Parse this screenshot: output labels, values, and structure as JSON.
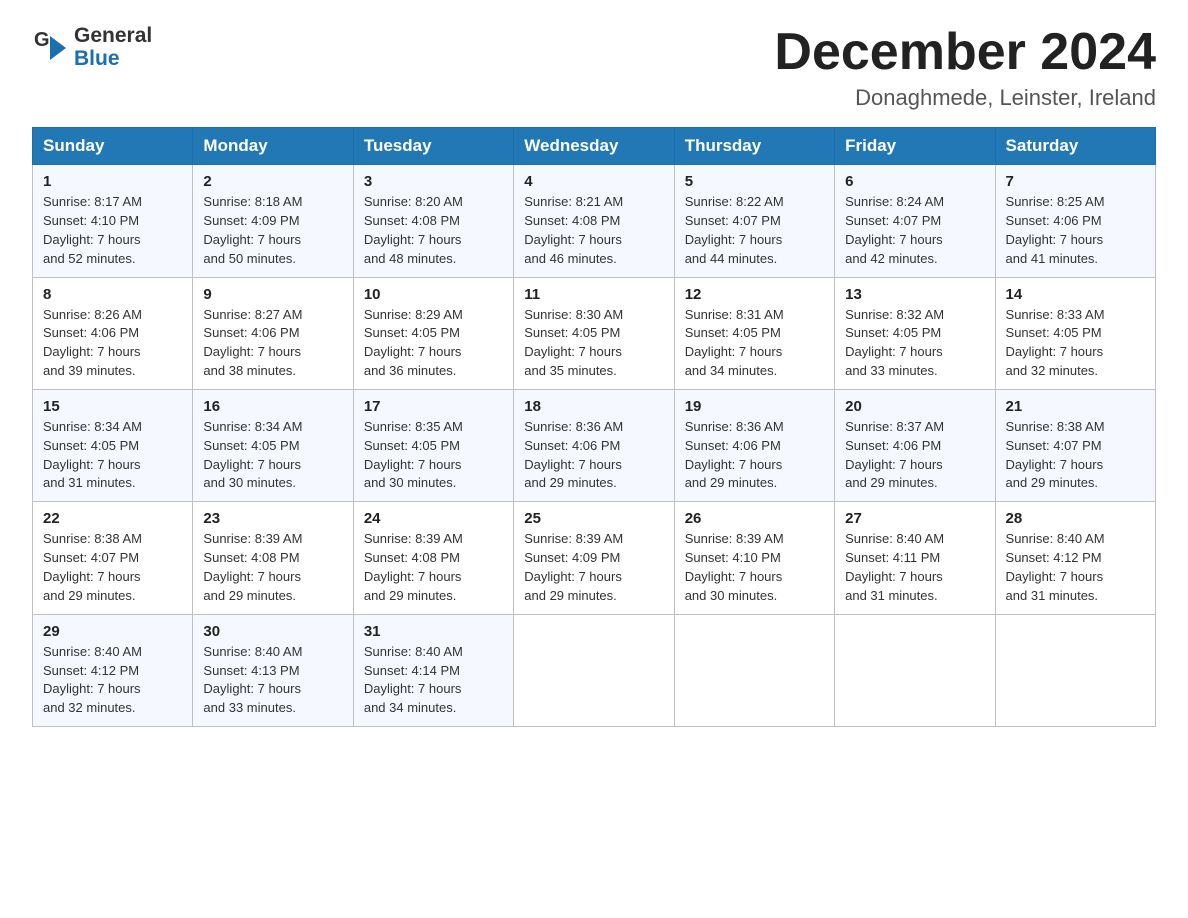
{
  "header": {
    "logo": {
      "general_text": "General",
      "blue_text": "Blue"
    },
    "title": "December 2024",
    "location": "Donaghmede, Leinster, Ireland"
  },
  "columns": [
    "Sunday",
    "Monday",
    "Tuesday",
    "Wednesday",
    "Thursday",
    "Friday",
    "Saturday"
  ],
  "weeks": [
    [
      {
        "day": "1",
        "info": "Sunrise: 8:17 AM\nSunset: 4:10 PM\nDaylight: 7 hours\nand 52 minutes."
      },
      {
        "day": "2",
        "info": "Sunrise: 8:18 AM\nSunset: 4:09 PM\nDaylight: 7 hours\nand 50 minutes."
      },
      {
        "day": "3",
        "info": "Sunrise: 8:20 AM\nSunset: 4:08 PM\nDaylight: 7 hours\nand 48 minutes."
      },
      {
        "day": "4",
        "info": "Sunrise: 8:21 AM\nSunset: 4:08 PM\nDaylight: 7 hours\nand 46 minutes."
      },
      {
        "day": "5",
        "info": "Sunrise: 8:22 AM\nSunset: 4:07 PM\nDaylight: 7 hours\nand 44 minutes."
      },
      {
        "day": "6",
        "info": "Sunrise: 8:24 AM\nSunset: 4:07 PM\nDaylight: 7 hours\nand 42 minutes."
      },
      {
        "day": "7",
        "info": "Sunrise: 8:25 AM\nSunset: 4:06 PM\nDaylight: 7 hours\nand 41 minutes."
      }
    ],
    [
      {
        "day": "8",
        "info": "Sunrise: 8:26 AM\nSunset: 4:06 PM\nDaylight: 7 hours\nand 39 minutes."
      },
      {
        "day": "9",
        "info": "Sunrise: 8:27 AM\nSunset: 4:06 PM\nDaylight: 7 hours\nand 38 minutes."
      },
      {
        "day": "10",
        "info": "Sunrise: 8:29 AM\nSunset: 4:05 PM\nDaylight: 7 hours\nand 36 minutes."
      },
      {
        "day": "11",
        "info": "Sunrise: 8:30 AM\nSunset: 4:05 PM\nDaylight: 7 hours\nand 35 minutes."
      },
      {
        "day": "12",
        "info": "Sunrise: 8:31 AM\nSunset: 4:05 PM\nDaylight: 7 hours\nand 34 minutes."
      },
      {
        "day": "13",
        "info": "Sunrise: 8:32 AM\nSunset: 4:05 PM\nDaylight: 7 hours\nand 33 minutes."
      },
      {
        "day": "14",
        "info": "Sunrise: 8:33 AM\nSunset: 4:05 PM\nDaylight: 7 hours\nand 32 minutes."
      }
    ],
    [
      {
        "day": "15",
        "info": "Sunrise: 8:34 AM\nSunset: 4:05 PM\nDaylight: 7 hours\nand 31 minutes."
      },
      {
        "day": "16",
        "info": "Sunrise: 8:34 AM\nSunset: 4:05 PM\nDaylight: 7 hours\nand 30 minutes."
      },
      {
        "day": "17",
        "info": "Sunrise: 8:35 AM\nSunset: 4:05 PM\nDaylight: 7 hours\nand 30 minutes."
      },
      {
        "day": "18",
        "info": "Sunrise: 8:36 AM\nSunset: 4:06 PM\nDaylight: 7 hours\nand 29 minutes."
      },
      {
        "day": "19",
        "info": "Sunrise: 8:36 AM\nSunset: 4:06 PM\nDaylight: 7 hours\nand 29 minutes."
      },
      {
        "day": "20",
        "info": "Sunrise: 8:37 AM\nSunset: 4:06 PM\nDaylight: 7 hours\nand 29 minutes."
      },
      {
        "day": "21",
        "info": "Sunrise: 8:38 AM\nSunset: 4:07 PM\nDaylight: 7 hours\nand 29 minutes."
      }
    ],
    [
      {
        "day": "22",
        "info": "Sunrise: 8:38 AM\nSunset: 4:07 PM\nDaylight: 7 hours\nand 29 minutes."
      },
      {
        "day": "23",
        "info": "Sunrise: 8:39 AM\nSunset: 4:08 PM\nDaylight: 7 hours\nand 29 minutes."
      },
      {
        "day": "24",
        "info": "Sunrise: 8:39 AM\nSunset: 4:08 PM\nDaylight: 7 hours\nand 29 minutes."
      },
      {
        "day": "25",
        "info": "Sunrise: 8:39 AM\nSunset: 4:09 PM\nDaylight: 7 hours\nand 29 minutes."
      },
      {
        "day": "26",
        "info": "Sunrise: 8:39 AM\nSunset: 4:10 PM\nDaylight: 7 hours\nand 30 minutes."
      },
      {
        "day": "27",
        "info": "Sunrise: 8:40 AM\nSunset: 4:11 PM\nDaylight: 7 hours\nand 31 minutes."
      },
      {
        "day": "28",
        "info": "Sunrise: 8:40 AM\nSunset: 4:12 PM\nDaylight: 7 hours\nand 31 minutes."
      }
    ],
    [
      {
        "day": "29",
        "info": "Sunrise: 8:40 AM\nSunset: 4:12 PM\nDaylight: 7 hours\nand 32 minutes."
      },
      {
        "day": "30",
        "info": "Sunrise: 8:40 AM\nSunset: 4:13 PM\nDaylight: 7 hours\nand 33 minutes."
      },
      {
        "day": "31",
        "info": "Sunrise: 8:40 AM\nSunset: 4:14 PM\nDaylight: 7 hours\nand 34 minutes."
      },
      {
        "day": "",
        "info": ""
      },
      {
        "day": "",
        "info": ""
      },
      {
        "day": "",
        "info": ""
      },
      {
        "day": "",
        "info": ""
      }
    ]
  ]
}
